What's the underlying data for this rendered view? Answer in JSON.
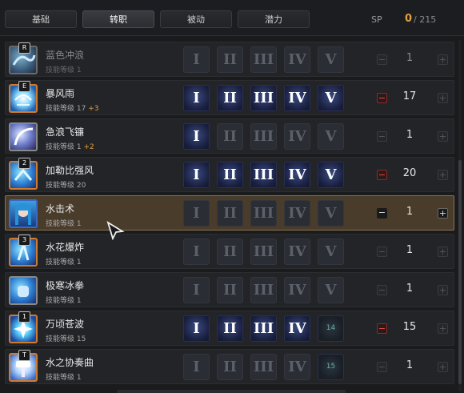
{
  "tabs": [
    "基础",
    "转职",
    "被动",
    "潜力"
  ],
  "sp": {
    "label": "SP",
    "value": "0",
    "max": "/ 215"
  },
  "roman": [
    "I",
    "II",
    "III",
    "IV",
    "V"
  ],
  "skills": [
    {
      "name": "蓝色冲浪",
      "level_text": "技能等级 1",
      "bonus": "",
      "points": "1",
      "badge": "R",
      "icon": "wave-surf-icon"
    },
    {
      "name": "暴风雨",
      "level_text": "技能等级 17",
      "bonus": "+3",
      "points": "17",
      "badge": "E",
      "icon": "storm-icon"
    },
    {
      "name": "急浪飞镰",
      "level_text": "技能等级 1",
      "bonus": "+2",
      "points": "1",
      "badge": "",
      "icon": "scythe-icon"
    },
    {
      "name": "加勒比强风",
      "level_text": "技能等级 20",
      "bonus": "",
      "points": "20",
      "badge": "2",
      "icon": "gale-icon"
    },
    {
      "name": "水击术",
      "level_text": "技能等级 1",
      "bonus": "",
      "points": "1",
      "badge": "",
      "icon": "character-portrait-icon"
    },
    {
      "name": "水花爆炸",
      "level_text": "技能等级 1",
      "bonus": "",
      "points": "1",
      "badge": "3",
      "icon": "splash-icon"
    },
    {
      "name": "极寒冰拳",
      "level_text": "技能等级 1",
      "bonus": "",
      "points": "1",
      "badge": "",
      "icon": "ice-fist-icon"
    },
    {
      "name": "万顷苍波",
      "level_text": "技能等级 15",
      "bonus": "",
      "points": "15",
      "badge": "1",
      "icon": "vast-wave-icon"
    },
    {
      "name": "水之协奏曲",
      "level_text": "技能等级 1",
      "bonus": "",
      "points": "1",
      "badge": "T",
      "icon": "water-concerto-icon"
    }
  ],
  "tier_numbers": {
    "row7": "14",
    "row8": "15"
  },
  "colors": {
    "accent": "#e0a040",
    "minus_active": "#ff4a4a",
    "selected_row": "#4a3c2a"
  }
}
